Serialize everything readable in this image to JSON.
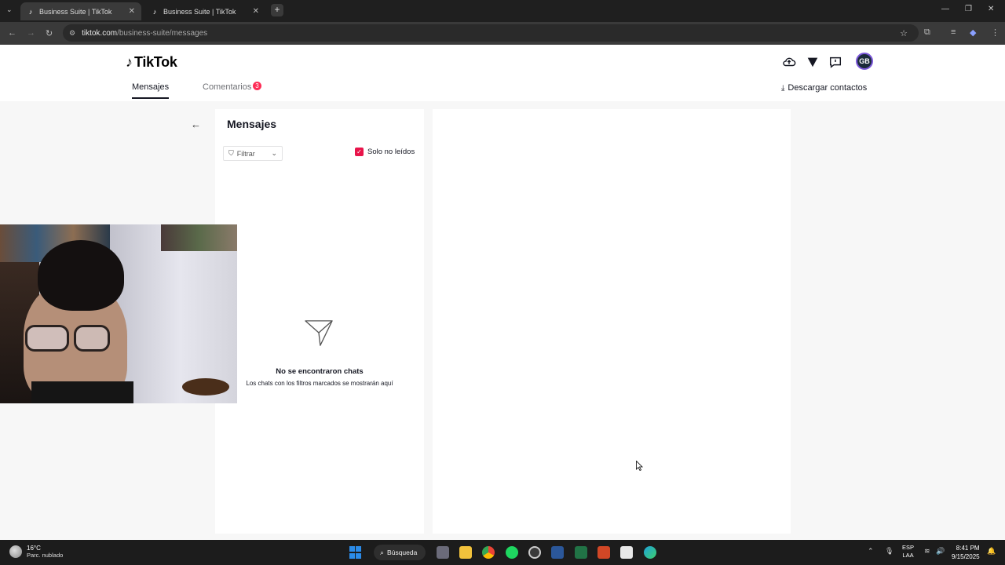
{
  "browser": {
    "tabs": [
      {
        "title": "Business Suite | TikTok",
        "active": true
      },
      {
        "title": "Business Suite | TikTok",
        "active": false
      }
    ],
    "url_host": "tiktok.com",
    "url_path": "/business-suite/messages"
  },
  "header": {
    "logo": "TikTok",
    "tabs": [
      {
        "label": "Mensajes",
        "active": true
      },
      {
        "label": "Comentarios",
        "active": false,
        "badge": "3"
      }
    ],
    "download_label": "Descargar contactos",
    "avatar_initials": "GB"
  },
  "messages": {
    "title": "Mensajes",
    "filter_label": "Filtrar",
    "unread_label": "Solo no leídos",
    "unread_checked": true,
    "empty_title": "No se encontraron chats",
    "empty_subtitle": "Los chats con los filtros marcados se mostrarán aquí"
  },
  "taskbar": {
    "weather_temp": "16°C",
    "weather_desc": "Parc. nublado",
    "search_label": "Búsqueda",
    "lang_top": "ESP",
    "lang_bottom": "LAA",
    "time": "8:41 PM",
    "date": "9/15/2025"
  },
  "colors": {
    "accent": "#fe2c55",
    "checkbox": "#e8144a",
    "browser_dark": "#1f1f1f"
  }
}
